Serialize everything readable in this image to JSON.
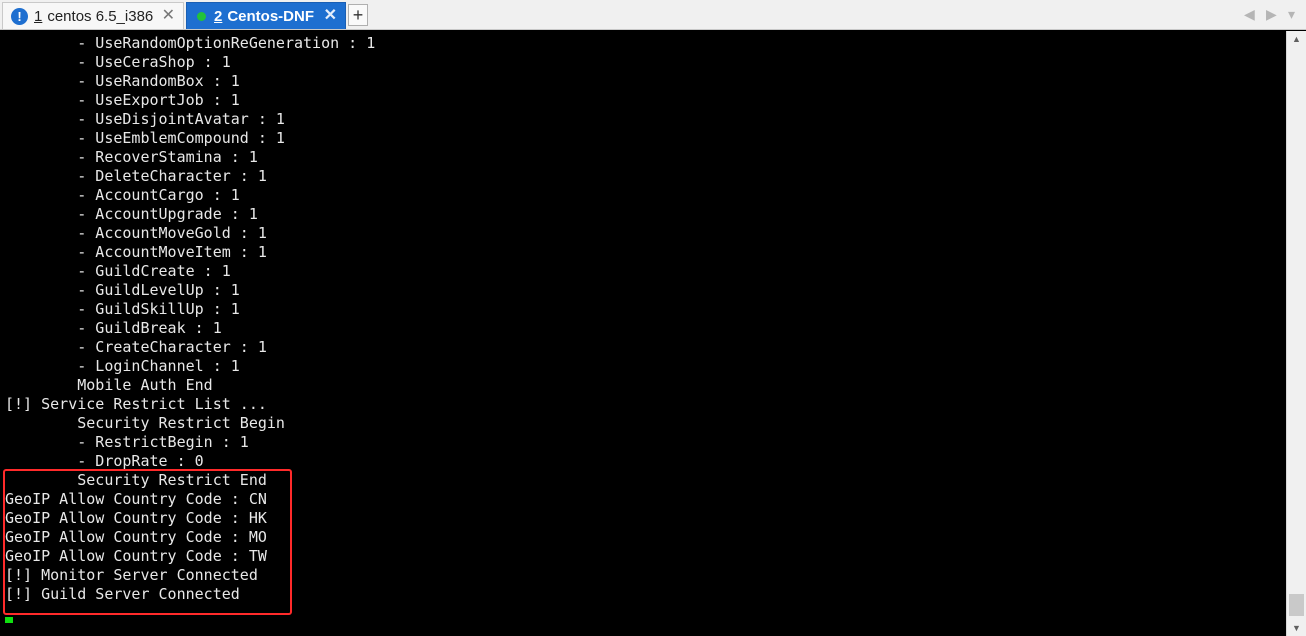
{
  "tabs": [
    {
      "number": "1",
      "label": "centos 6.5_i386",
      "status": "warning"
    },
    {
      "number": "2",
      "label": "Centos-DNF",
      "status": "connected"
    }
  ],
  "icons": {
    "warning": "!",
    "close": "✕",
    "new_tab": "+",
    "nav_left": "◀",
    "nav_right": "▶",
    "nav_menu": "▾",
    "scroll_up": "▲",
    "scroll_down": "▼"
  },
  "colors": {
    "active_tab": "#1e6fd0",
    "status_connected": "#22c23a",
    "highlight_border": "#ff2a2a",
    "terminal_bg": "#000000",
    "terminal_fg": "#e8e8e8",
    "cursor": "#10e010"
  },
  "terminal": {
    "lines": [
      "        - UseRandomOptionReGeneration : 1",
      "        - UseCeraShop : 1",
      "        - UseRandomBox : 1",
      "        - UseExportJob : 1",
      "        - UseDisjointAvatar : 1",
      "        - UseEmblemCompound : 1",
      "        - RecoverStamina : 1",
      "        - DeleteCharacter : 1",
      "        - AccountCargo : 1",
      "        - AccountUpgrade : 1",
      "        - AccountMoveGold : 1",
      "        - AccountMoveItem : 1",
      "        - GuildCreate : 1",
      "        - GuildLevelUp : 1",
      "        - GuildSkillUp : 1",
      "        - GuildBreak : 1",
      "        - CreateCharacter : 1",
      "        - LoginChannel : 1",
      "        Mobile Auth End",
      "[!] Service Restrict List ...",
      "        Security Restrict Begin",
      "        - RestrictBegin : 1",
      "        - DropRate : 0",
      "        Security Restrict End",
      "GeoIP Allow Country Code : CN",
      "GeoIP Allow Country Code : HK",
      "GeoIP Allow Country Code : MO",
      "GeoIP Allow Country Code : TW",
      "[!] Monitor Server Connected",
      "[!] Guild Server Connected"
    ]
  }
}
